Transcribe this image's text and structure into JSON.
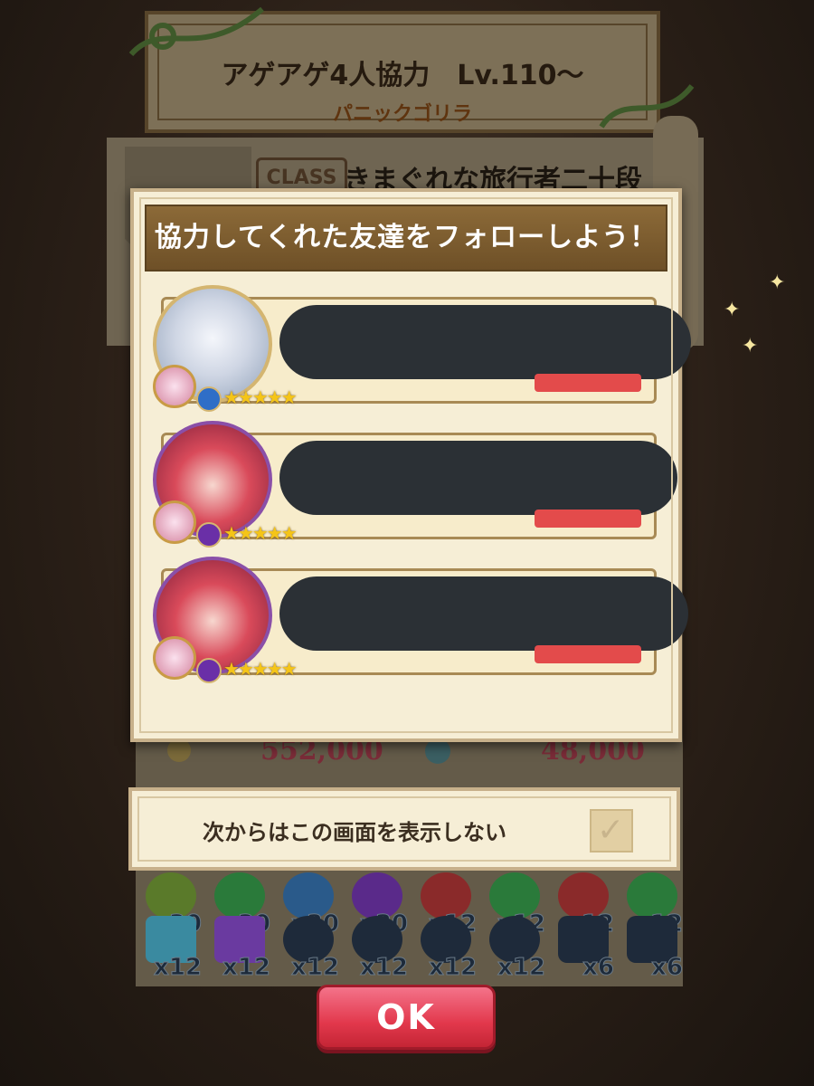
{
  "quest": {
    "title": "アゲアゲ4人協力　Lv.110～",
    "subtitle": "パニックゴリラ"
  },
  "result": {
    "class_badge": "CLASS",
    "class_text": "きまぐれな旅行者二十段",
    "coin_value": "552,000",
    "exp_value": "48,000"
  },
  "rewards": {
    "row1": [
      "x30",
      "x30",
      "x30",
      "x30",
      "x12",
      "x12",
      "x12",
      "x12"
    ],
    "row2": [
      "x12",
      "x12",
      "x12",
      "x12",
      "x12",
      "x12",
      "x6",
      "x6"
    ]
  },
  "dialog": {
    "title": "協力してくれた友達をフォローしよう！",
    "friends": [
      {
        "element": "water",
        "stars": "★★★★★"
      },
      {
        "element": "dark",
        "stars": "★★★★★"
      },
      {
        "element": "dark",
        "stars": "★★★★★"
      }
    ]
  },
  "checkbox": {
    "label": "次からはこの画面を表示しない",
    "checked": false
  },
  "ok_button": "OK",
  "colors": {
    "ok_button": "#e2384c",
    "header": "#7a5a2e",
    "follow_button": "#e34b4b"
  }
}
